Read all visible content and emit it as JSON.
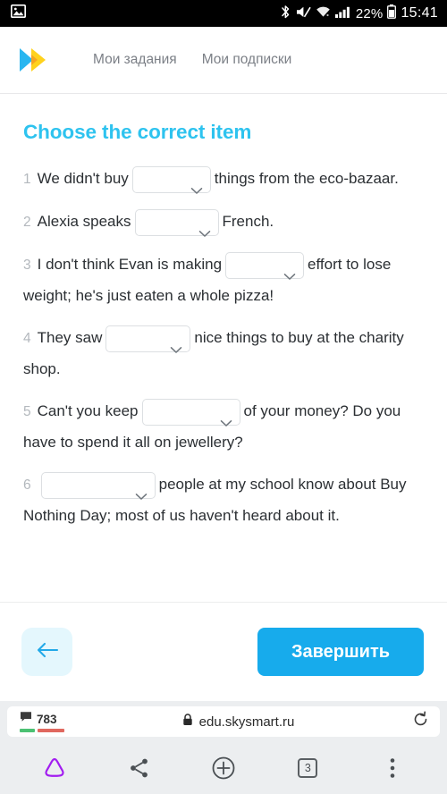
{
  "statusbar": {
    "left_icon": "image-icon",
    "icons": [
      "bluetooth-icon",
      "mute-icon",
      "wifi-icon",
      "signal-icon"
    ],
    "battery_percent": "22%",
    "battery_icon": "battery-icon",
    "clock": "15:41"
  },
  "header": {
    "logo": "skysmart-logo",
    "nav": [
      {
        "label": "Мои задания"
      },
      {
        "label": "Мои подписки"
      }
    ]
  },
  "exercise": {
    "title": "Choose the correct item",
    "accent_color": "#2ec3ef",
    "questions": [
      {
        "num": "1",
        "before": "We didn't buy",
        "value": "",
        "after": "things from the eco-bazaar.",
        "dropdown_width": 88
      },
      {
        "num": "2",
        "before": "Alexia speaks",
        "value": "",
        "after": "French.",
        "dropdown_width": 94
      },
      {
        "num": "3",
        "before": "I don't think Evan is making",
        "value": "",
        "after": "effort to lose weight; he's just eaten a whole pizza!",
        "dropdown_width": 88
      },
      {
        "num": "4",
        "before": "They saw",
        "value": "",
        "after": "nice things to buy at the charity shop.",
        "dropdown_width": 95
      },
      {
        "num": "5",
        "before": "Can't you keep",
        "value": "",
        "after": "of your money? Do you have to spend it all on jewellery?",
        "dropdown_width": 110
      },
      {
        "num": "6",
        "before": "",
        "value": "",
        "after": "people at my school know about Buy Nothing Day; most of us haven't heard about it.",
        "dropdown_width": 128
      }
    ]
  },
  "actions": {
    "back_icon": "arrow-left-icon",
    "finish_label": "Завершить",
    "finish_color": "#17abec",
    "back_bg_color": "#e4f7fd"
  },
  "browser": {
    "blocked_count": "783",
    "lock_icon": "lock-icon",
    "url": "edu.skysmart.ru",
    "reload_icon": "reload-icon",
    "nav_icons": [
      "home-triangle-icon",
      "share-icon",
      "new-tab-icon",
      "tabs-icon",
      "menu-dots-icon"
    ],
    "tab_count": "3"
  }
}
